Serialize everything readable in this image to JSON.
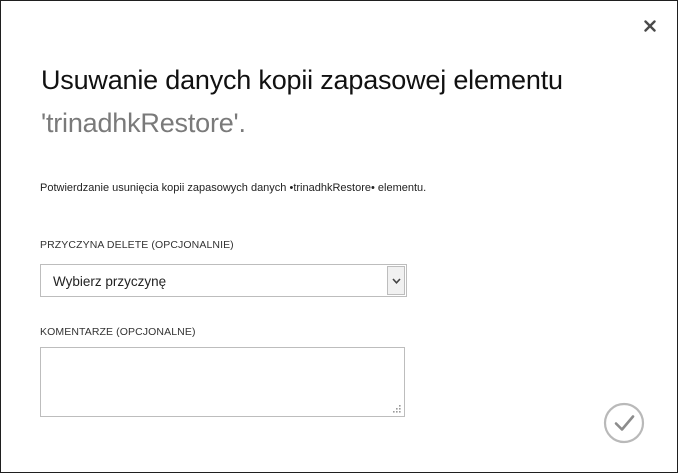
{
  "dialog": {
    "title_main": "Usuwanie danych kopii zapasowej elementu",
    "title_item": "'trinadhkRestore'.",
    "description": "Potwierdzanie usunięcia kopii zapasowych danych •trinadhkRestore• elementu.",
    "close_icon": "close-icon",
    "confirm_icon": "checkmark-icon"
  },
  "form": {
    "reason_label": "PRZYCZYNA DELETE (OPCJONALNIE)",
    "reason_selected": "Wybierz przyczynę",
    "comments_label": "KOMENTARZE (OPCJONALNE)",
    "comments_value": ""
  },
  "colors": {
    "title": "#111111",
    "item_name": "#7a7a7a",
    "border": "#bdbdbd",
    "confirm_circle": "#b9b9b9"
  }
}
